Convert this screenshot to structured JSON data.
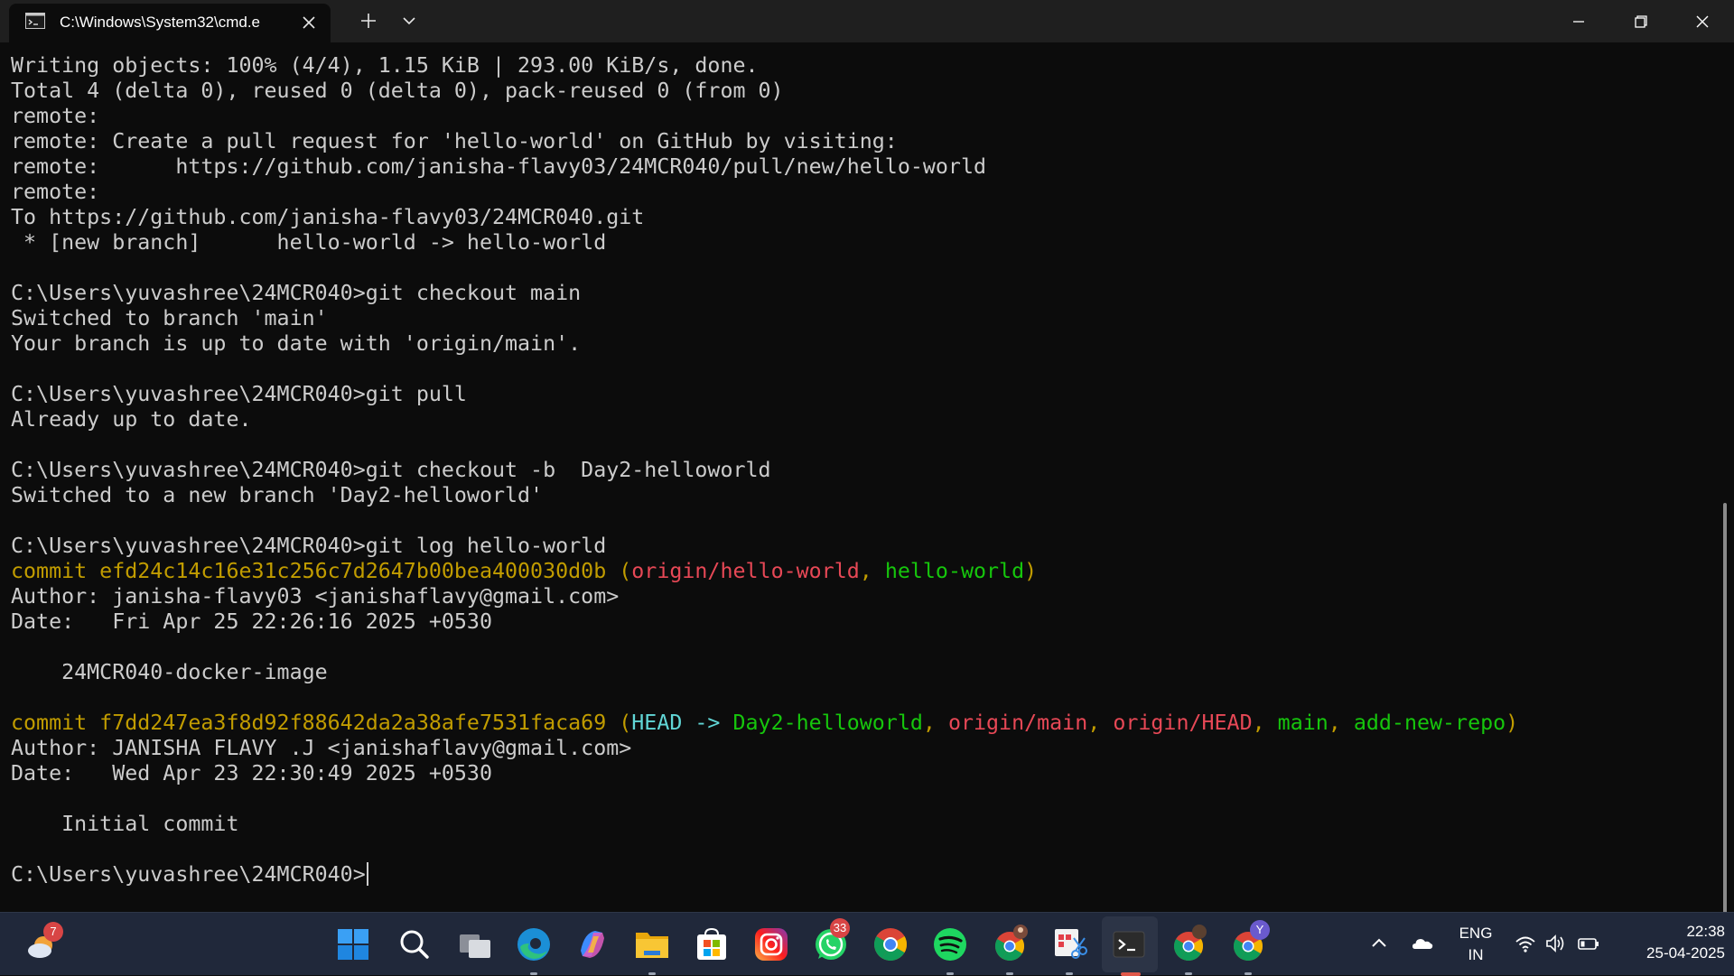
{
  "window": {
    "tab_title": "C:\\Windows\\System32\\cmd.e",
    "tab_icon": "cmd-icon",
    "close_tab_icon": "close-icon",
    "new_tab_icon": "plus-icon",
    "dropdown_icon": "chevron-down-icon",
    "controls": [
      "minimize-icon",
      "restore-icon",
      "close-icon"
    ]
  },
  "terminal": {
    "lines": [
      [
        {
          "t": "Writing objects: 100% (4/4), 1.15 KiB | 293.00 KiB/s, done."
        }
      ],
      [
        {
          "t": "Total 4 (delta 0), reused 0 (delta 0), pack-reused 0 (from 0)"
        }
      ],
      [
        {
          "t": "remote:"
        }
      ],
      [
        {
          "t": "remote: Create a pull request for 'hello-world' on GitHub by visiting:"
        }
      ],
      [
        {
          "t": "remote:      https://github.com/janisha-flavy03/24MCR040/pull/new/hello-world"
        }
      ],
      [
        {
          "t": "remote:"
        }
      ],
      [
        {
          "t": "To https://github.com/janisha-flavy03/24MCR040.git"
        }
      ],
      [
        {
          "t": " * [new branch]      hello-world -> hello-world"
        }
      ],
      [
        {
          "t": ""
        }
      ],
      [
        {
          "t": "C:\\Users\\yuvashree\\24MCR040>git checkout main"
        }
      ],
      [
        {
          "t": "Switched to branch 'main'"
        }
      ],
      [
        {
          "t": "Your branch is up to date with 'origin/main'."
        }
      ],
      [
        {
          "t": ""
        }
      ],
      [
        {
          "t": "C:\\Users\\yuvashree\\24MCR040>git pull"
        }
      ],
      [
        {
          "t": "Already up to date."
        }
      ],
      [
        {
          "t": ""
        }
      ],
      [
        {
          "t": "C:\\Users\\yuvashree\\24MCR040>git checkout -b  Day2-helloworld"
        }
      ],
      [
        {
          "t": "Switched to a new branch 'Day2-helloworld'"
        }
      ],
      [
        {
          "t": ""
        }
      ],
      [
        {
          "t": "C:\\Users\\yuvashree\\24MCR040>git log hello-world"
        }
      ],
      [
        {
          "t": "commit efd24c14c16e31c256c7d2647b00bea400030d0b (",
          "c": "yellow"
        },
        {
          "t": "origin/hello-world",
          "c": "red"
        },
        {
          "t": ", ",
          "c": "yellow"
        },
        {
          "t": "hello-world",
          "c": "green"
        },
        {
          "t": ")",
          "c": "yellow"
        }
      ],
      [
        {
          "t": "Author: janisha-flavy03 <janishaflavy@gmail.com>"
        }
      ],
      [
        {
          "t": "Date:   Fri Apr 25 22:26:16 2025 +0530"
        }
      ],
      [
        {
          "t": ""
        }
      ],
      [
        {
          "t": "    24MCR040-docker-image"
        }
      ],
      [
        {
          "t": ""
        }
      ],
      [
        {
          "t": "commit f7dd247ea3f8d92f88642da2a38afe7531faca69 (",
          "c": "yellow"
        },
        {
          "t": "HEAD -> ",
          "c": "cyan"
        },
        {
          "t": "Day2-helloworld",
          "c": "green"
        },
        {
          "t": ", ",
          "c": "yellow"
        },
        {
          "t": "origin/main",
          "c": "red"
        },
        {
          "t": ", ",
          "c": "yellow"
        },
        {
          "t": "origin/HEAD",
          "c": "red"
        },
        {
          "t": ", ",
          "c": "yellow"
        },
        {
          "t": "main",
          "c": "green"
        },
        {
          "t": ", ",
          "c": "yellow"
        },
        {
          "t": "add-new-repo",
          "c": "green"
        },
        {
          "t": ")",
          "c": "yellow"
        }
      ],
      [
        {
          "t": "Author: JANISHA FLAVY .J <janishaflavy@gmail.com>"
        }
      ],
      [
        {
          "t": "Date:   Wed Apr 23 22:30:49 2025 +0530"
        }
      ],
      [
        {
          "t": ""
        }
      ],
      [
        {
          "t": "    Initial commit"
        }
      ],
      [
        {
          "t": ""
        }
      ],
      [
        {
          "t": "C:\\Users\\yuvashree\\24MCR040>",
          "cursor": true
        }
      ]
    ]
  },
  "taskbar": {
    "weather_badge": "7",
    "whatsapp_badge": "33",
    "chrome_profile_badge": "Y",
    "lang_top": "ENG",
    "lang_bottom": "IN",
    "time": "22:38",
    "date": "25-04-2025",
    "icons": [
      "weather-icon",
      "start-icon",
      "search-icon",
      "task-view-icon",
      "edge-icon",
      "copilot-icon",
      "file-explorer-icon",
      "microsoft-store-icon",
      "instagram-icon",
      "whatsapp-icon",
      "chrome-icon",
      "spotify-icon",
      "chrome-profile-icon",
      "snipping-tool-icon",
      "terminal-icon",
      "chrome-profile-2-icon",
      "chrome-profile-3-icon"
    ],
    "tray": [
      "chevron-up-icon",
      "onedrive-icon",
      "wifi-icon",
      "volume-icon",
      "battery-icon"
    ]
  }
}
